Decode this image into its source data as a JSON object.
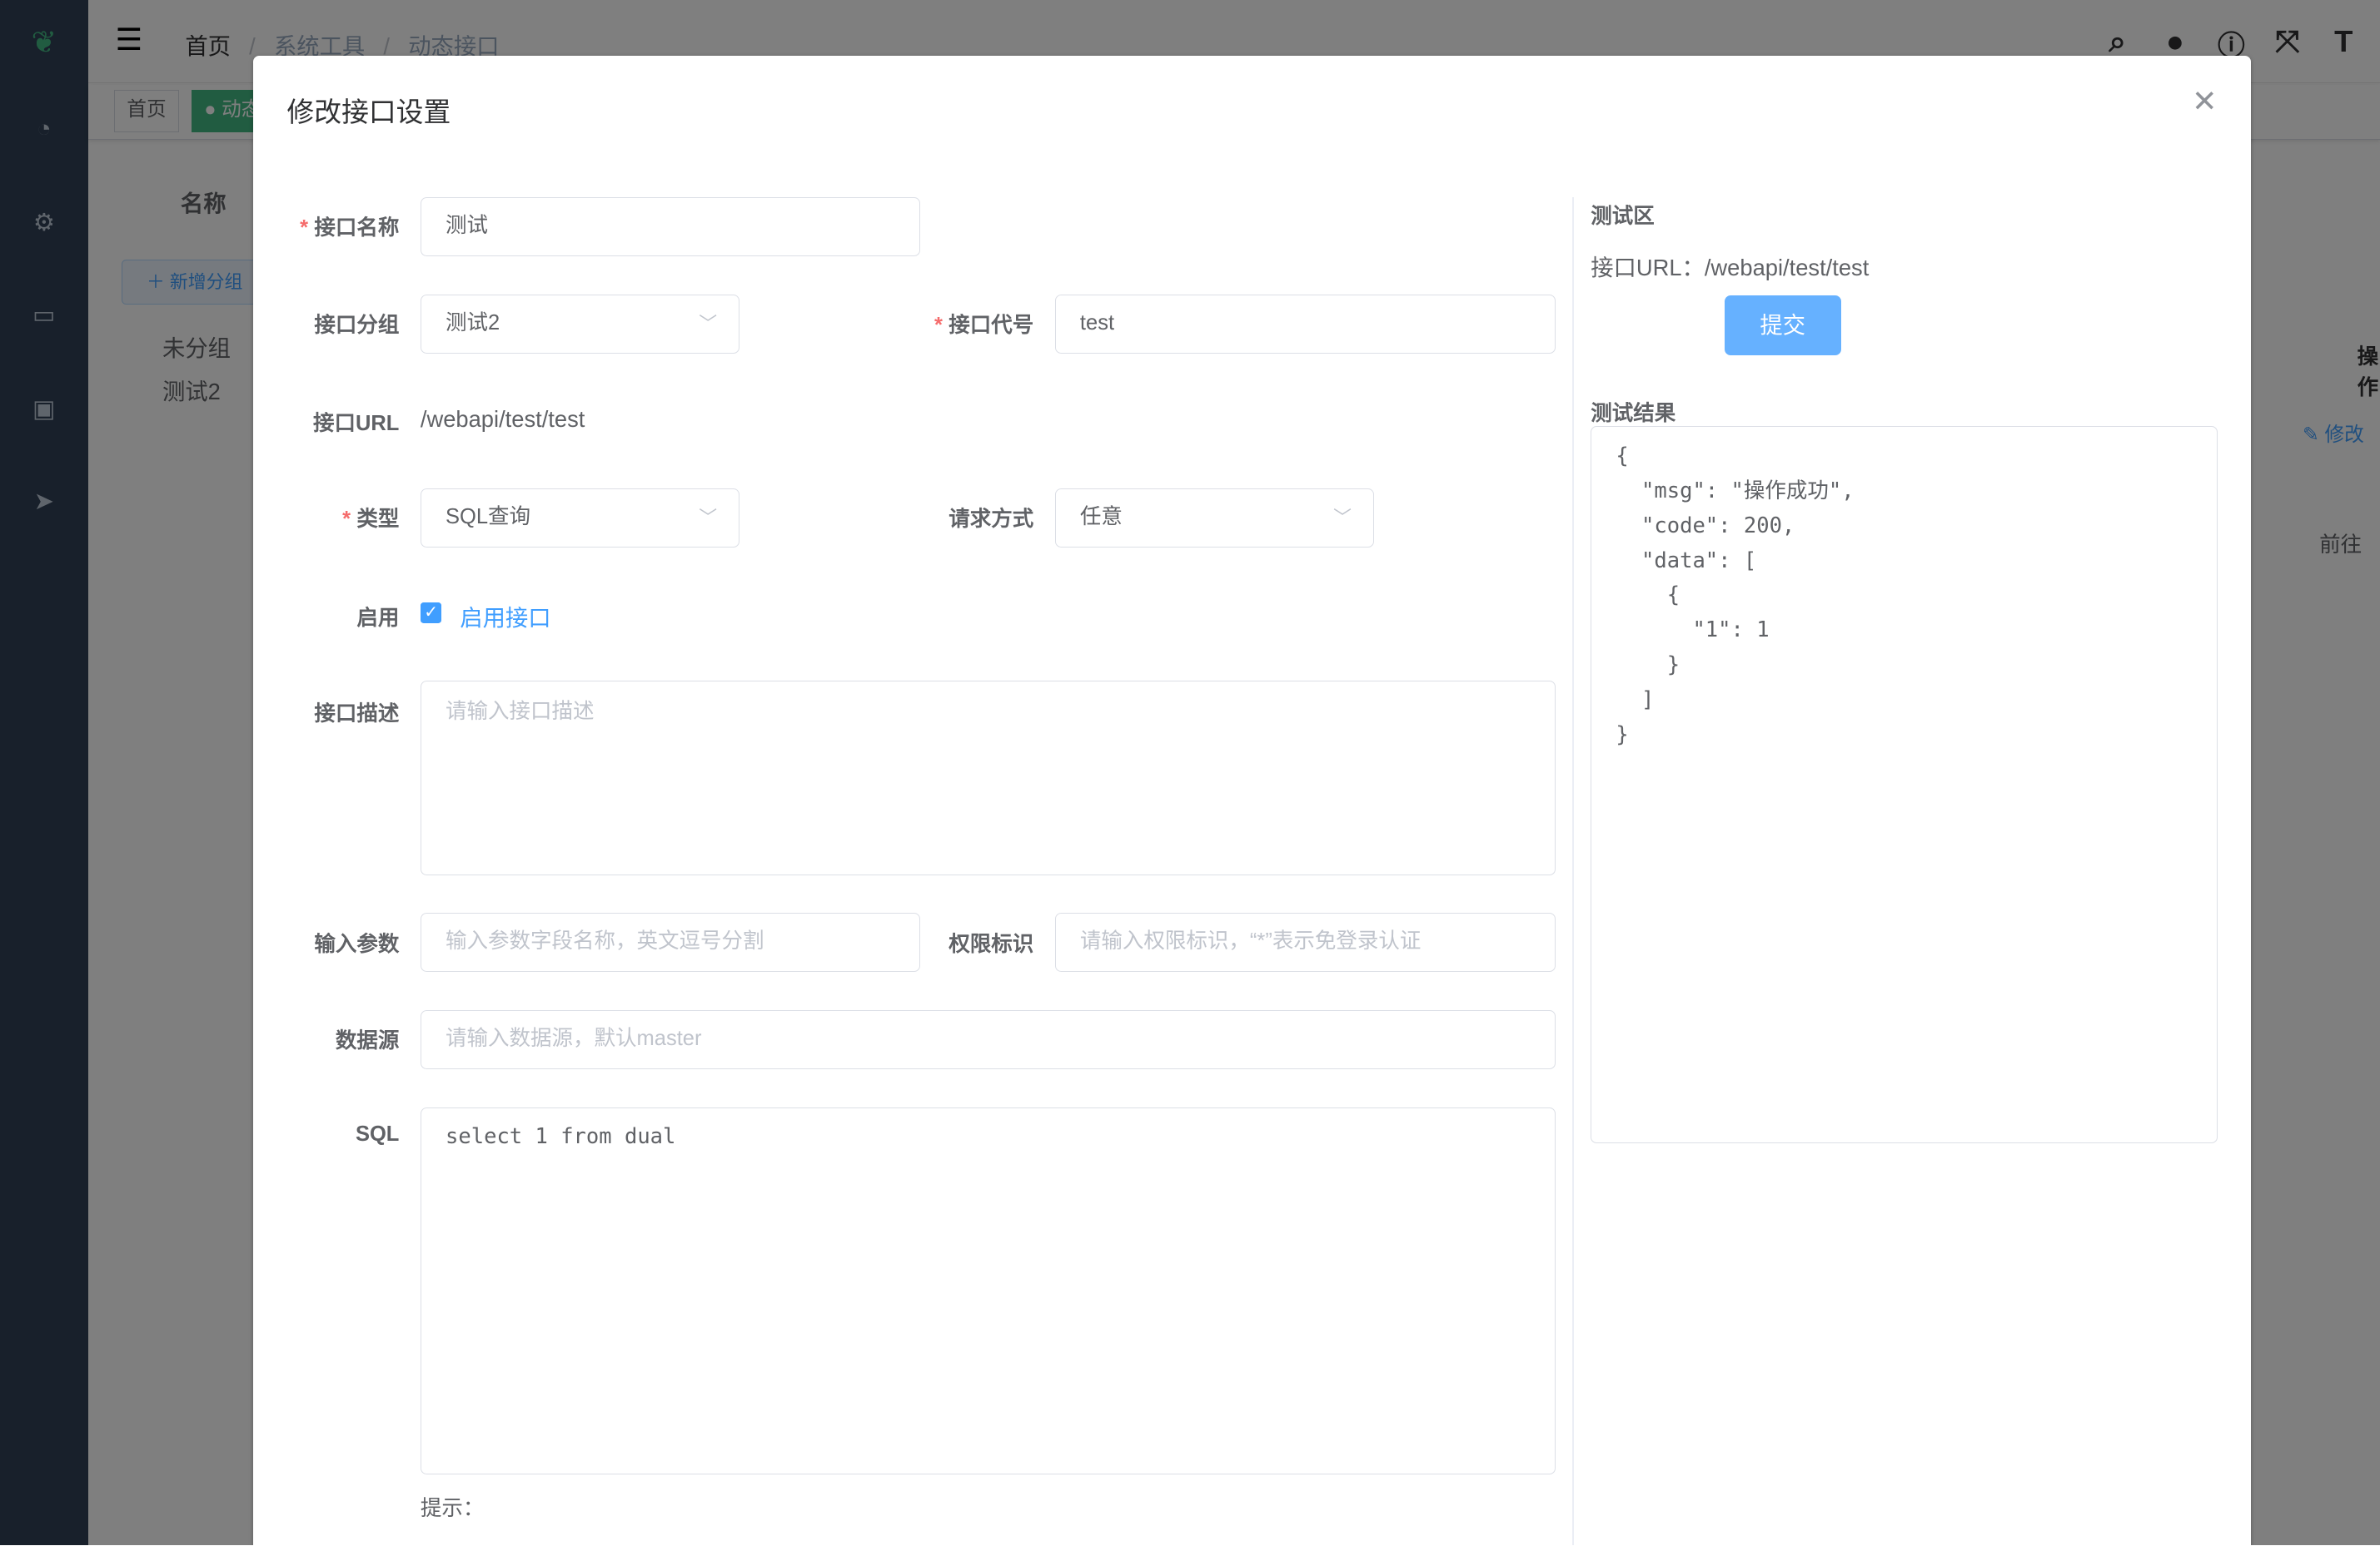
{
  "background": {
    "breadcrumb": [
      "首页",
      "系统工具",
      "动态接口"
    ],
    "tags": [
      "首页",
      "动态接口"
    ],
    "search_label": "名称",
    "add_group_button": "新增分组",
    "groups": [
      "未分组",
      "测试2"
    ],
    "table_header_action": "操作",
    "row_edit_link": "修改",
    "pagination_goto": "前往",
    "header_icons": [
      "search-icon",
      "github-icon",
      "help-icon",
      "fullscreen-icon",
      "font-size-icon"
    ]
  },
  "dialog": {
    "title": "修改接口设置",
    "form": {
      "name": {
        "label": "接口名称",
        "value": "测试"
      },
      "group": {
        "label": "接口分组",
        "value": "测试2"
      },
      "code": {
        "label": "接口代号",
        "value": "test"
      },
      "url": {
        "label": "接口URL",
        "value": "/webapi/test/test"
      },
      "type": {
        "label": "类型",
        "value": "SQL查询"
      },
      "method": {
        "label": "请求方式",
        "value": "任意"
      },
      "enabled": {
        "label": "启用",
        "checkbox_label": "启用接口",
        "checked": true
      },
      "description": {
        "label": "接口描述",
        "placeholder": "请输入接口描述"
      },
      "params": {
        "label": "输入参数",
        "placeholder": "输入参数字段名称，英文逗号分割"
      },
      "permission": {
        "label": "权限标识",
        "placeholder": "请输入权限标识，“*”表示免登录认证"
      },
      "datasource": {
        "label": "数据源",
        "placeholder": "请输入数据源，默认master"
      },
      "sql": {
        "label": "SQL",
        "value": "select 1 from dual"
      },
      "hint": "提示："
    },
    "test": {
      "title": "测试区",
      "url_label": "接口URL：",
      "url_value": "/webapi/test/test",
      "submit_label": "提交",
      "result_label": "测试结果",
      "result_value": "{\n  \"msg\": \"操作成功\",\n  \"code\": 200,\n  \"data\": [\n    {\n      \"1\": 1\n    }\n  ]\n}"
    }
  },
  "colors": {
    "primary": "#409eff",
    "submit": "#66b1ff",
    "sidebar": "#304156",
    "required": "#f56c6c"
  }
}
